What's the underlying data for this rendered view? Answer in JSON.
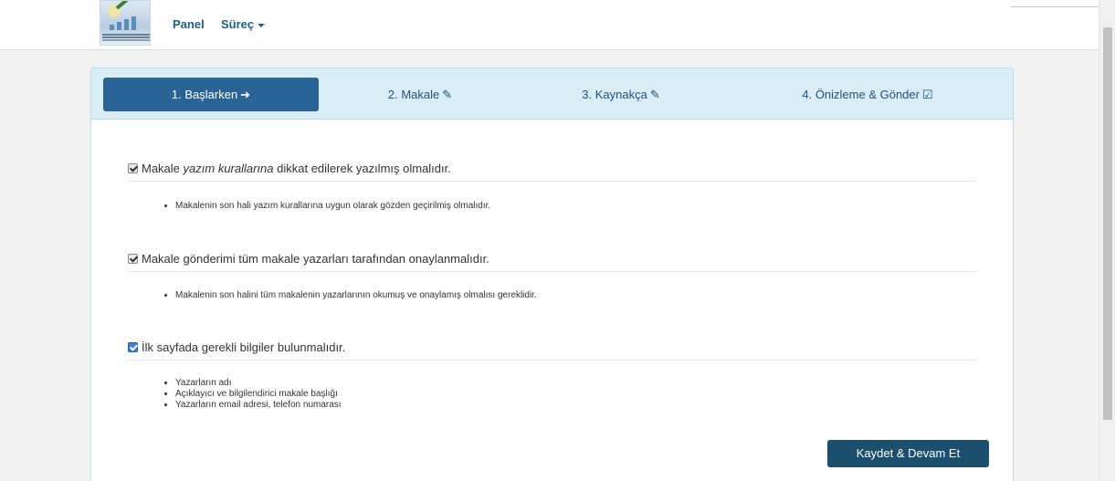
{
  "navbar": {
    "panel_label": "Panel",
    "surec_label": "Süreç"
  },
  "wizard": {
    "steps": [
      {
        "label": "1. Başlarken",
        "icon": "arrow-right-icon",
        "glyph": "➔",
        "active": true
      },
      {
        "label": "2. Makale",
        "icon": "edit-icon",
        "glyph": "✎",
        "active": false
      },
      {
        "label": "3. Kaynakça",
        "icon": "edit-icon",
        "glyph": "✎",
        "active": false
      },
      {
        "label": "4. Önizleme & Gönder",
        "icon": "check-square-icon",
        "glyph": "☑",
        "active": false
      }
    ]
  },
  "checklist": {
    "item1": {
      "pre": "Makale ",
      "em": "yazım kurallarına",
      "post": " dikkat edilerek yazılmış olmalıdır.",
      "bullets": [
        "Makalenin son hali yazım kurallarına uygun olarak gözden geçirilmiş olmalıdır."
      ]
    },
    "item2": {
      "text": "Makale gönderimi tüm makale yazarları tarafından onaylanmalıdır.",
      "bullets": [
        "Makalenin son halini tüm makalenin yazarlarının okumuş ve onaylamış olmalısı gereklidir."
      ]
    },
    "item3": {
      "text": "İlk sayfada gerekli bilgiler bulunmalıdır.",
      "bullets": [
        "Yazarların adı",
        "Açıklayıcı ve bilgilendirici makale başlığı",
        "Yazarların email adresi, telefon numarası"
      ]
    }
  },
  "actions": {
    "save_label": "Kaydet & Devam Et"
  },
  "colors": {
    "primary": "#2a6496",
    "wizard_bg": "#d9edf7",
    "button": "#1c4e6e"
  }
}
